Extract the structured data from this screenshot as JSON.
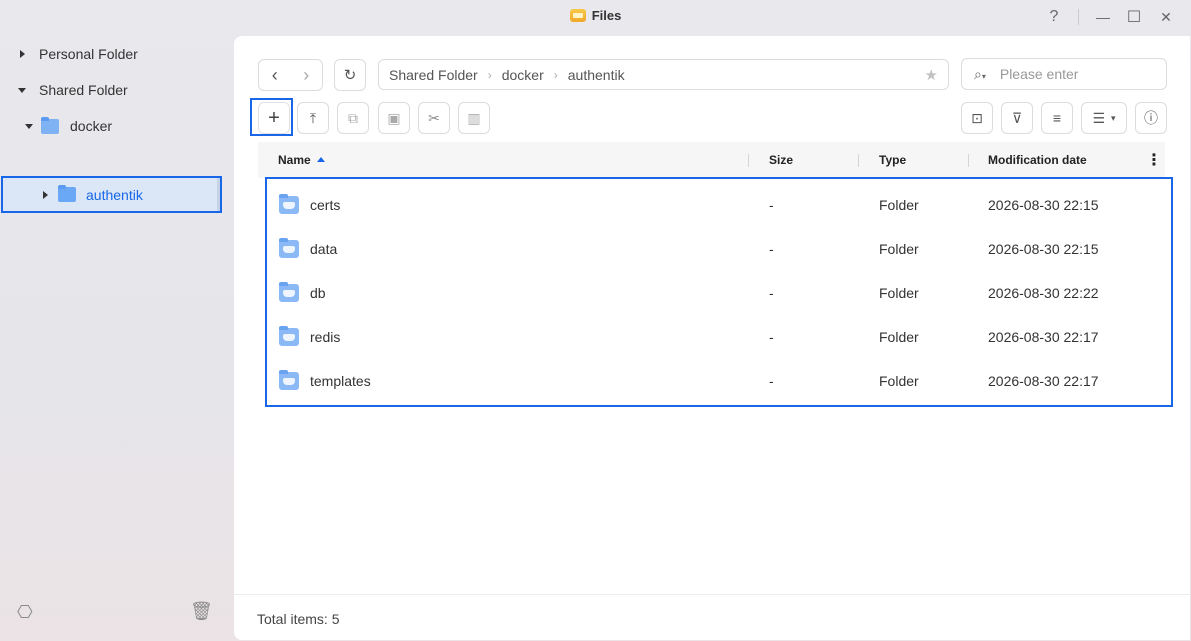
{
  "window": {
    "title": "Files",
    "help_glyph": "?",
    "minimize_glyph": "—",
    "maximize_glyph": "☐",
    "close_glyph": "✕"
  },
  "sidebar": {
    "items": [
      {
        "label": "Personal Folder",
        "expanded": false
      },
      {
        "label": "Shared Folder",
        "expanded": true
      },
      {
        "label": "docker",
        "expanded": true
      },
      {
        "label": "authentik",
        "selected": true
      }
    ]
  },
  "toolbar": {
    "back_glyph": "‹",
    "forward_glyph": "›",
    "refresh_glyph": "↻",
    "add_glyph": "+",
    "upload_glyph": "⤒",
    "copy_glyph": "⧉",
    "paste_glyph": "▣",
    "cut_glyph": "✂",
    "more_glyph": "▥",
    "toolbox_glyph": "⊡",
    "filter_glyph": "⊽",
    "sort_glyph": "≡",
    "view_glyph": "☰",
    "view_caret": "▾",
    "info_glyph": "ⓘ"
  },
  "breadcrumb": [
    "Shared Folder",
    "docker",
    "authentik"
  ],
  "breadcrumb_sep": "›",
  "search": {
    "placeholder": "Please enter",
    "caret": "▾"
  },
  "table": {
    "columns": [
      "Name",
      "Size",
      "Type",
      "Modification date"
    ],
    "more_glyph": "⋮",
    "rows": [
      {
        "name": "certs",
        "size": "-",
        "type": "Folder",
        "modified": "2026-08-30 22:15"
      },
      {
        "name": "data",
        "size": "-",
        "type": "Folder",
        "modified": "2026-08-30 22:15"
      },
      {
        "name": "db",
        "size": "-",
        "type": "Folder",
        "modified": "2026-08-30 22:22"
      },
      {
        "name": "redis",
        "size": "-",
        "type": "Folder",
        "modified": "2026-08-30 22:17"
      },
      {
        "name": "templates",
        "size": "-",
        "type": "Folder",
        "modified": "2026-08-30 22:17"
      }
    ]
  },
  "footer": {
    "total_label": "Total items: 5"
  },
  "colors": {
    "accent": "#1867e8",
    "folder": "#8bb9f5"
  }
}
